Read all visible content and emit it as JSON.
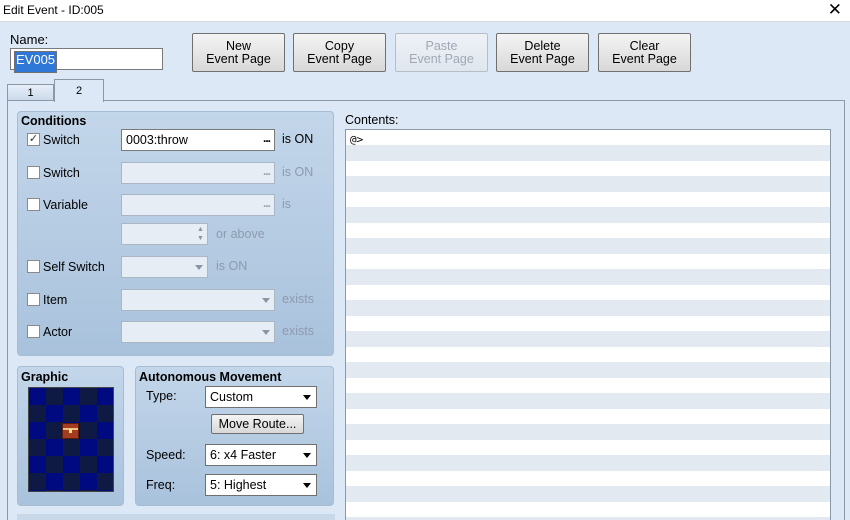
{
  "window": {
    "title": "Edit Event - ID:005",
    "close_icon": "close-icon"
  },
  "name": {
    "label": "Name:",
    "value": "EV005"
  },
  "page_buttons": [
    {
      "line1": "New",
      "line2": "Event Page",
      "enabled": true
    },
    {
      "line1": "Copy",
      "line2": "Event Page",
      "enabled": true
    },
    {
      "line1": "Paste",
      "line2": "Event Page",
      "enabled": false
    },
    {
      "line1": "Delete",
      "line2": "Event Page",
      "enabled": true
    },
    {
      "line1": "Clear",
      "line2": "Event Page",
      "enabled": true
    }
  ],
  "tabs": [
    {
      "label": "1"
    },
    {
      "label": "2",
      "active": true
    }
  ],
  "conditions": {
    "title": "Conditions",
    "switch1": {
      "label": "Switch",
      "checked": true,
      "value": "0003:throw",
      "after": "is ON"
    },
    "switch2": {
      "label": "Switch",
      "checked": false,
      "value": "",
      "after": "is ON"
    },
    "variable": {
      "label": "Variable",
      "checked": false,
      "value": "",
      "after": "is",
      "stepper_value": "",
      "stepper_after": "or above"
    },
    "self_switch": {
      "label": "Self Switch",
      "checked": false,
      "value": "",
      "after": "is ON"
    },
    "item": {
      "label": "Item",
      "checked": false,
      "value": "",
      "after": "exists"
    },
    "actor": {
      "label": "Actor",
      "checked": false,
      "value": "",
      "after": "exists"
    }
  },
  "graphic": {
    "title": "Graphic"
  },
  "movement": {
    "title": "Autonomous Movement",
    "type_label": "Type:",
    "type_value": "Custom",
    "move_route": "Move Route...",
    "speed_label": "Speed:",
    "speed_value": "6: x4 Faster",
    "freq_label": "Freq:",
    "freq_value": "5: Highest"
  },
  "contents": {
    "label": "Contents:",
    "lines": [
      "@>"
    ]
  },
  "colors": {
    "panel_bg": "#dce8f5",
    "group_bg": "#b6cbe2",
    "selection": "#3078d8"
  }
}
